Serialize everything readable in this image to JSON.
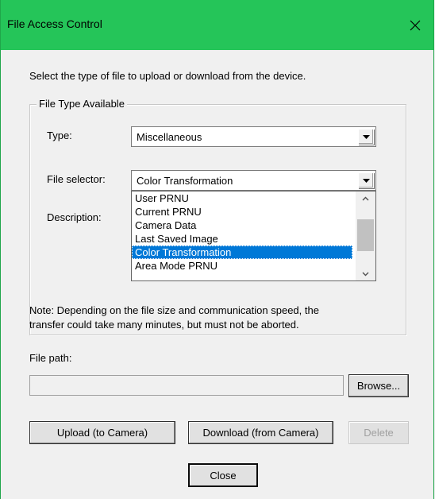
{
  "window": {
    "title": "File Access Control",
    "intro": "Select the type of file to upload or download from the device."
  },
  "group": {
    "legend": "File Type Available",
    "type_label": "Type:",
    "type_value": "Miscellaneous",
    "selector_label": "File selector:",
    "selector_value": "Color Transformation",
    "description_label": "Description:",
    "dropdown_items": [
      "User PRNU",
      "Current PRNU",
      "Camera Data",
      "Last Saved Image",
      "Color Transformation",
      "Area Mode PRNU"
    ],
    "selected_item": "Color Transformation",
    "note_line1": "Note: Depending on the file size and communication speed, the",
    "note_line2": "transfer could take many minutes, but must not be aborted."
  },
  "file_path": {
    "label": "File path:",
    "value": ""
  },
  "buttons": {
    "browse": "Browse...",
    "upload": "Upload (to Camera)",
    "download": "Download (from Camera)",
    "delete": "Delete",
    "close": "Close"
  },
  "colors": {
    "titlebar": "#25c559",
    "selection": "#0078d7"
  }
}
